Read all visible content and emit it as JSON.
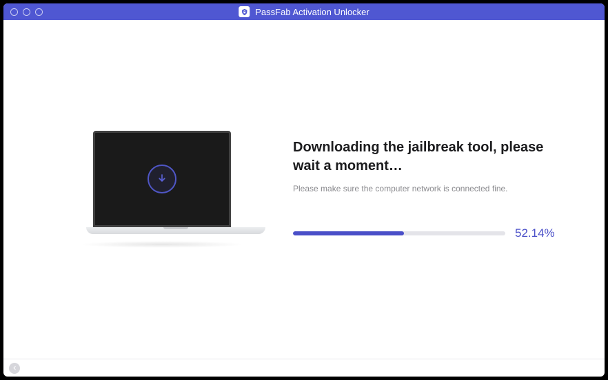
{
  "titlebar": {
    "app_name": "PassFab Activation Unlocker"
  },
  "main": {
    "heading": "Downloading the jailbreak tool, please wait a moment…",
    "subtext": "Please make sure the computer network is connected fine.",
    "progress_percent": 52.14,
    "progress_label": "52.14%"
  },
  "colors": {
    "brand": "#4f57d2",
    "progress": "#4a4fc8"
  }
}
